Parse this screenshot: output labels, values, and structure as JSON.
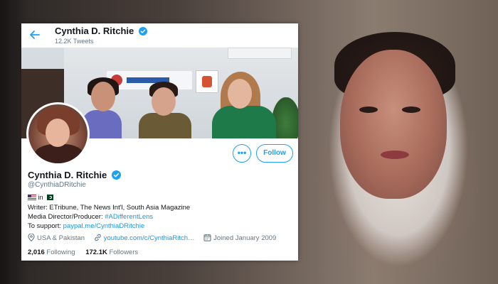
{
  "header": {
    "name": "Cynthia D. Ritchie",
    "tweet_count": "12.2K Tweets"
  },
  "profile": {
    "name": "Cynthia D. Ritchie",
    "handle": "@CynthiaDRitchie",
    "location_line_in": "in",
    "bio": {
      "line1": "Writer: ETribune, The News Int'l, South Asia Magazine",
      "line2_prefix": "Media Director/Producer: ",
      "line2_link": "#ADifferentLens",
      "line3_prefix": "To support: ",
      "line3_link": "paypal.me/CynthiaDRitchie"
    },
    "location": "USA & Pakistan",
    "website": "youtube.com/c/CynthiaRitch…",
    "joined": "Joined January 2009",
    "following_count": "2,016",
    "following_label": "Following",
    "followers_count": "172.1K",
    "followers_label": "Followers"
  },
  "actions": {
    "more_label": "•••",
    "follow_label": "Follow"
  },
  "colors": {
    "accent": "#1da1f2",
    "link": "#1b95e0",
    "text": "#14171a",
    "muted": "#657786"
  }
}
